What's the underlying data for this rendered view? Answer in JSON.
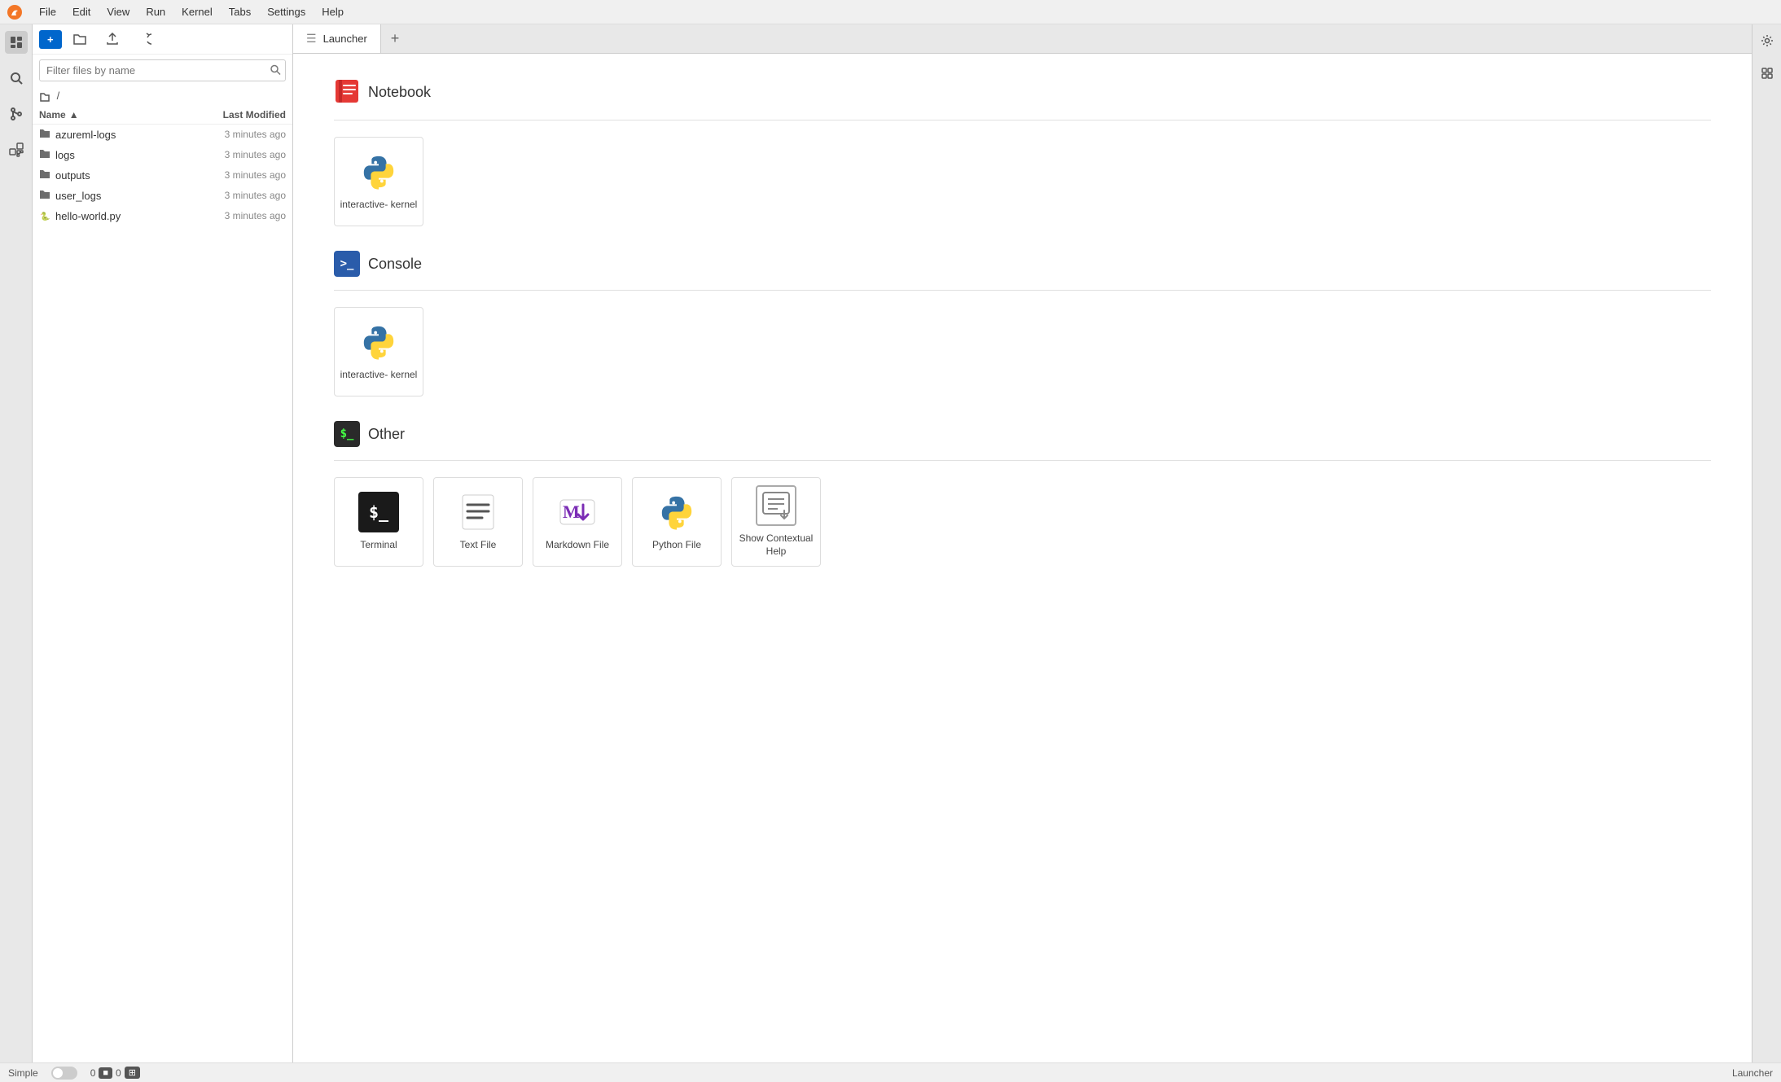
{
  "menubar": {
    "items": [
      "File",
      "Edit",
      "View",
      "Run",
      "Kernel",
      "Tabs",
      "Settings",
      "Help"
    ]
  },
  "sidebar": {
    "new_button": "+",
    "search_placeholder": "Filter files by name",
    "breadcrumb": "/",
    "columns": {
      "name": "Name",
      "modified": "Last Modified"
    },
    "files": [
      {
        "name": "azureml-logs",
        "type": "folder",
        "modified": "3 minutes ago"
      },
      {
        "name": "logs",
        "type": "folder",
        "modified": "3 minutes ago"
      },
      {
        "name": "outputs",
        "type": "folder",
        "modified": "3 minutes ago"
      },
      {
        "name": "user_logs",
        "type": "folder",
        "modified": "3 minutes ago"
      },
      {
        "name": "hello-world.py",
        "type": "python",
        "modified": "3 minutes ago"
      }
    ]
  },
  "tabs": [
    {
      "label": "Launcher",
      "icon": "launcher-icon"
    }
  ],
  "launcher": {
    "sections": [
      {
        "id": "notebook",
        "title": "Notebook",
        "cards": [
          {
            "label": "interactive-\nkernel",
            "type": "python-kernel"
          }
        ]
      },
      {
        "id": "console",
        "title": "Console",
        "cards": [
          {
            "label": "interactive-\nkernel",
            "type": "python-kernel"
          }
        ]
      },
      {
        "id": "other",
        "title": "Other",
        "cards": [
          {
            "label": "Terminal",
            "type": "terminal"
          },
          {
            "label": "Text File",
            "type": "textfile"
          },
          {
            "label": "Markdown File",
            "type": "markdown"
          },
          {
            "label": "Python File",
            "type": "pythonfile"
          },
          {
            "label": "Show Contextual Help",
            "type": "help"
          }
        ]
      }
    ]
  },
  "statusbar": {
    "mode": "Simple",
    "kernel_count": "0",
    "terminal_count": "0",
    "launcher_label": "Launcher"
  }
}
